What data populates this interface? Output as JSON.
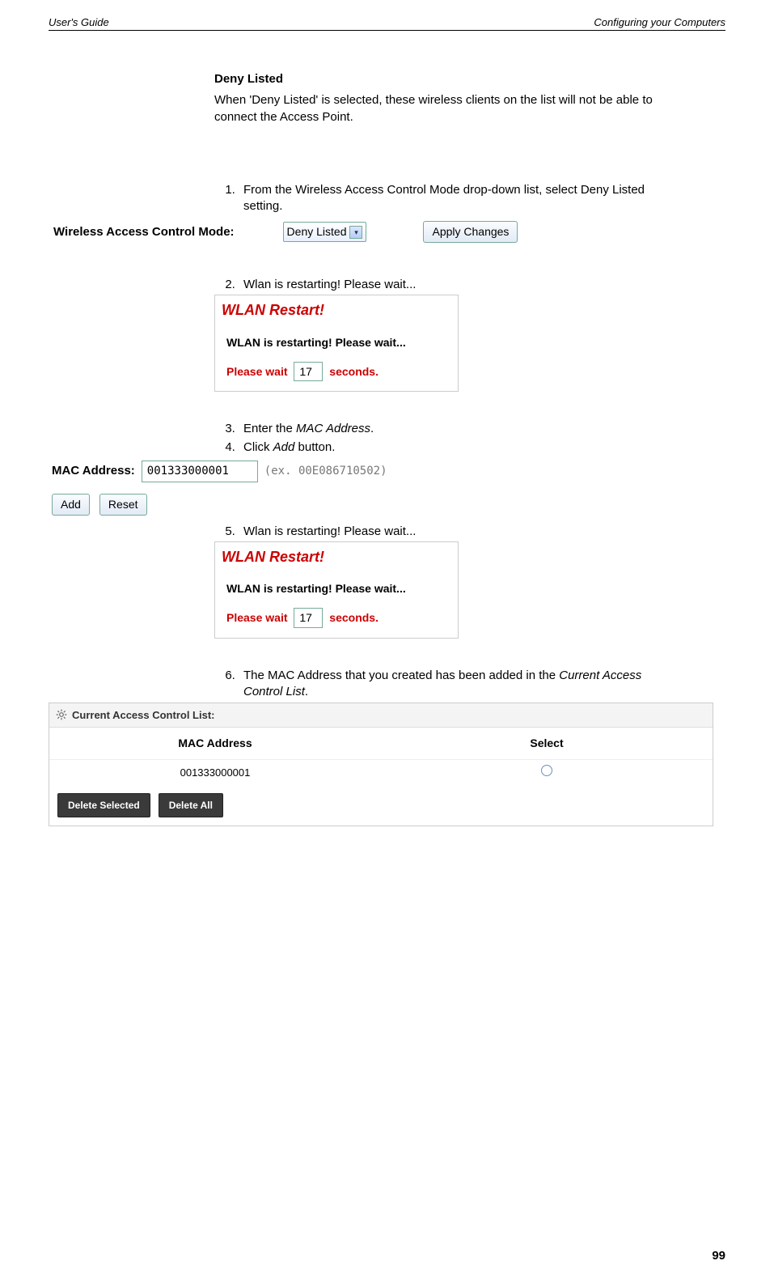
{
  "header": {
    "left": "User's Guide",
    "right": "Configuring your Computers"
  },
  "section": {
    "heading": "Deny Listed",
    "intro": "When 'Deny Listed' is selected, these wireless clients on the list will not be able to connect the Access Point."
  },
  "steps": {
    "s1": "From the Wireless Access Control Mode drop-down list, select Deny Listed setting.",
    "s2": "Wlan is restarting! Please wait...",
    "s3_pre": "Enter the ",
    "s3_em": "MAC Address",
    "s3_post": ".",
    "s4_pre": "Click ",
    "s4_em": "Add",
    "s4_post": " button.",
    "s5": "Wlan is restarting! Please wait...",
    "s6_pre": "The MAC Address that you created has been added in the ",
    "s6_em": "Current Access Control List",
    "s6_post": "."
  },
  "wac": {
    "label": "Wireless Access Control Mode:",
    "selected": "Deny Listed",
    "apply_btn": "Apply Changes"
  },
  "restart": {
    "title": "WLAN Restart!",
    "line": "WLAN is restarting! Please wait...",
    "please_wait": "Please wait",
    "count": "17",
    "seconds": "seconds."
  },
  "mac": {
    "label": "MAC Address:",
    "value": "001333000001",
    "example": "(ex. 00E086710502)",
    "add_btn": "Add",
    "reset_btn": "Reset"
  },
  "acl": {
    "title": "Current Access Control List:",
    "cols": {
      "mac": "MAC Address",
      "select": "Select"
    },
    "rows": [
      {
        "mac": "001333000001"
      }
    ],
    "del_sel": "Delete Selected",
    "del_all": "Delete All"
  },
  "page_number": "99"
}
